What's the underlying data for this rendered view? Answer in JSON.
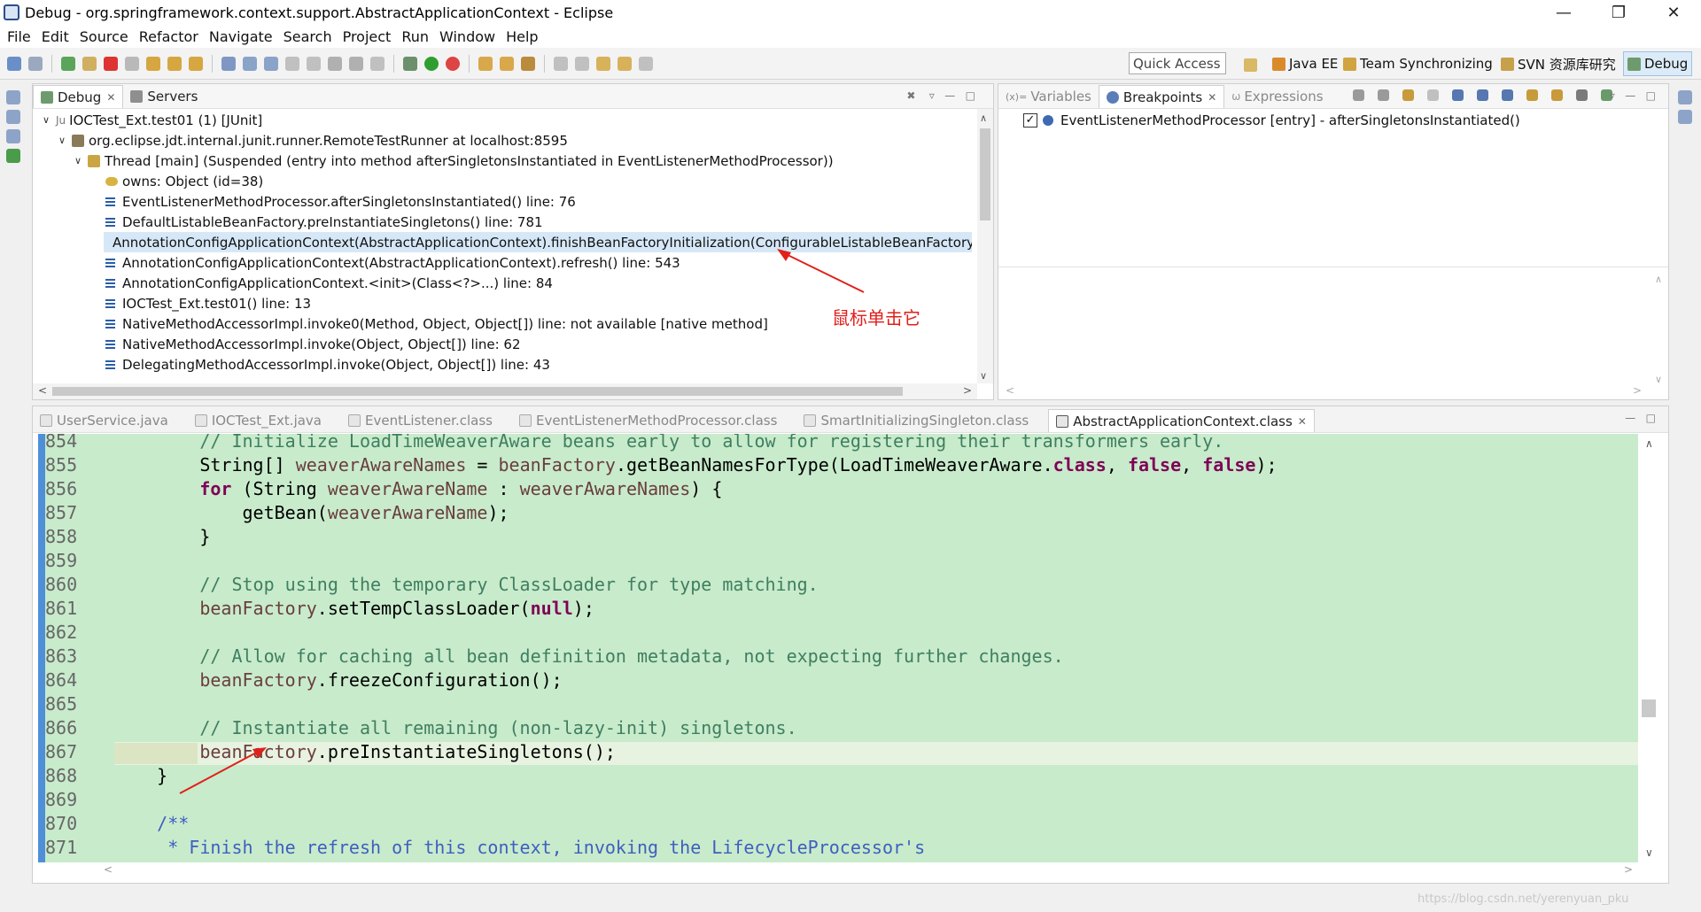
{
  "window": {
    "title": "Debug - org.springframework.context.support.AbstractApplicationContext - Eclipse"
  },
  "menu": [
    "File",
    "Edit",
    "Source",
    "Refactor",
    "Navigate",
    "Search",
    "Project",
    "Run",
    "Window",
    "Help"
  ],
  "quick_access": {
    "placeholder": "Quick Access"
  },
  "perspectives": [
    "Java EE",
    "Team Synchronizing",
    "SVN 资源库研究",
    "Debug"
  ],
  "debug_view": {
    "tabs": [
      "Debug",
      "Servers"
    ],
    "tree": [
      "IOCTest_Ext.test01 (1) [JUnit]",
      "org.eclipse.jdt.internal.junit.runner.RemoteTestRunner at localhost:8595",
      "Thread [main] (Suspended (entry into method afterSingletonsInstantiated in EventListenerMethodProcessor))",
      "owns: Object  (id=38)",
      "EventListenerMethodProcessor.afterSingletonsInstantiated() line: 76",
      "DefaultListableBeanFactory.preInstantiateSingletons() line: 781",
      "AnnotationConfigApplicationContext(AbstractApplicationContext).finishBeanFactoryInitialization(ConfigurableListableBeanFactory) l",
      "AnnotationConfigApplicationContext(AbstractApplicationContext).refresh() line: 543",
      "AnnotationConfigApplicationContext.<init>(Class<?>...) line: 84",
      "IOCTest_Ext.test01() line: 13",
      "NativeMethodAccessorImpl.invoke0(Method, Object, Object[]) line: not available [native method]",
      "NativeMethodAccessorImpl.invoke(Object, Object[]) line: 62",
      "DelegatingMethodAccessorImpl.invoke(Object, Object[]) line: 43"
    ],
    "annotation": "鼠标单击它"
  },
  "breakpoints_view": {
    "tabs": [
      "Variables",
      "Breakpoints",
      "Expressions"
    ],
    "items": [
      "EventListenerMethodProcessor [entry] - afterSingletonsInstantiated()"
    ]
  },
  "editor": {
    "tabs": [
      "UserService.java",
      "IOCTest_Ext.java",
      "EventListener.class",
      "EventListenerMethodProcessor.class",
      "SmartInitializingSingleton.class",
      "AbstractApplicationContext.class"
    ],
    "line_numbers": [
      "854",
      "855",
      "856",
      "857",
      "858",
      "859",
      "860",
      "861",
      "862",
      "863",
      "864",
      "865",
      "866",
      "867",
      "868",
      "869",
      "870",
      "871"
    ],
    "lines": [
      "        // Initialize LoadTimeWeaverAware beans early to allow for registering their transformers early.",
      "        String[] weaverAwareNames = beanFactory.getBeanNamesForType(LoadTimeWeaverAware.class, false, false);",
      "        for (String weaverAwareName : weaverAwareNames) {",
      "            getBean(weaverAwareName);",
      "        }",
      "",
      "        // Stop using the temporary ClassLoader for type matching.",
      "        beanFactory.setTempClassLoader(null);",
      "",
      "        // Allow for caching all bean definition metadata, not expecting further changes.",
      "        beanFactory.freezeConfiguration();",
      "",
      "        // Instantiate all remaining (non-lazy-init) singletons.",
      "        beanFactory.preInstantiateSingletons();",
      "    }",
      "",
      "    /**",
      "     * Finish the refresh of this context, invoking the LifecycleProcessor's"
    ]
  },
  "watermark": "https://blog.csdn.net/yerenyuan_pku",
  "colors": {
    "editor_bg": "#c8ebcc",
    "keyword": "#7f0055",
    "comment": "#3f7f5f",
    "javadoc": "#3f5fbf",
    "selection": "#d6e8f7",
    "arrow": "#e0201b"
  }
}
